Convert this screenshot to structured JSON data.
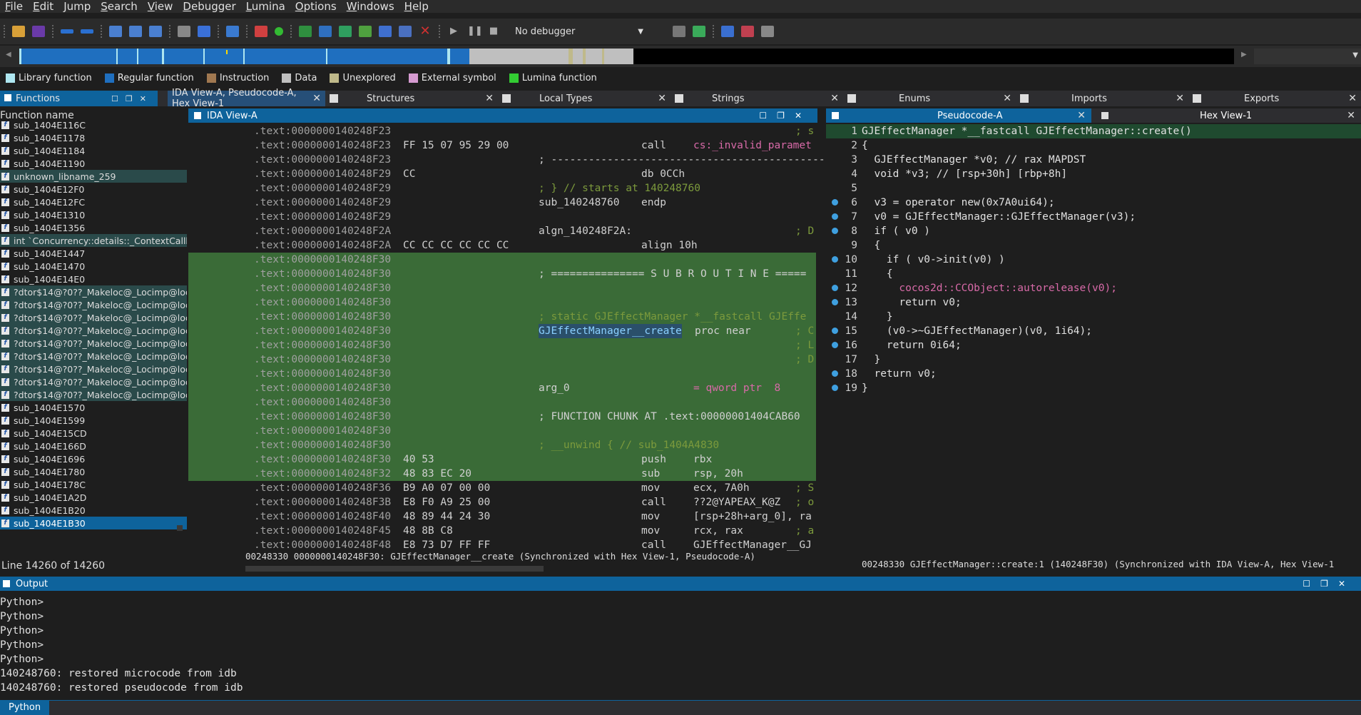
{
  "menu": [
    "File",
    "Edit",
    "Jump",
    "Search",
    "View",
    "Debugger",
    "Lumina",
    "Options",
    "Windows",
    "Help"
  ],
  "toolbar": {
    "debugger_label": "No debugger",
    "dropdown_arrow": "▼"
  },
  "legend": [
    {
      "label": "Library function",
      "color": "#aee6f0"
    },
    {
      "label": "Regular function",
      "color": "#1f6fbf"
    },
    {
      "label": "Instruction",
      "color": "#a07850"
    },
    {
      "label": "Data",
      "color": "#c0c0c0"
    },
    {
      "label": "Unexplored",
      "color": "#bfb98a"
    },
    {
      "label": "External symbol",
      "color": "#d59ad0"
    },
    {
      "label": "Lumina function",
      "color": "#33cc33"
    }
  ],
  "functions_panel": {
    "title": "Functions",
    "column_header": "Function name",
    "status": "Line 14260 of 14260",
    "rows": [
      {
        "name": "sub_1404E116C",
        "type": "normal"
      },
      {
        "name": "sub_1404E1178",
        "type": "normal"
      },
      {
        "name": "sub_1404E1184",
        "type": "normal"
      },
      {
        "name": "sub_1404E1190",
        "type": "normal"
      },
      {
        "name": "unknown_libname_259",
        "type": "lib"
      },
      {
        "name": "sub_1404E12F0",
        "type": "normal"
      },
      {
        "name": "sub_1404E12FC",
        "type": "normal"
      },
      {
        "name": "sub_1404E1310",
        "type": "normal"
      },
      {
        "name": "sub_1404E1356",
        "type": "normal"
      },
      {
        "name": "int `Concurrency::details::_ContextCallb",
        "type": "lib"
      },
      {
        "name": "sub_1404E1447",
        "type": "normal"
      },
      {
        "name": "sub_1404E1470",
        "type": "normal"
      },
      {
        "name": "sub_1404E14E0",
        "type": "normal"
      },
      {
        "name": "?dtor$14@?0??_Makeloc@_Locimp@loca",
        "type": "lib"
      },
      {
        "name": "?dtor$14@?0??_Makeloc@_Locimp@loca",
        "type": "lib"
      },
      {
        "name": "?dtor$14@?0??_Makeloc@_Locimp@loca",
        "type": "lib"
      },
      {
        "name": "?dtor$14@?0??_Makeloc@_Locimp@loca",
        "type": "lib"
      },
      {
        "name": "?dtor$14@?0??_Makeloc@_Locimp@loca",
        "type": "lib"
      },
      {
        "name": "?dtor$14@?0??_Makeloc@_Locimp@loca",
        "type": "lib"
      },
      {
        "name": "?dtor$14@?0??_Makeloc@_Locimp@loca",
        "type": "lib"
      },
      {
        "name": "?dtor$14@?0??_Makeloc@_Locimp@loca",
        "type": "lib"
      },
      {
        "name": "?dtor$14@?0??_Makeloc@_Locimp@loca",
        "type": "lib"
      },
      {
        "name": "sub_1404E1570",
        "type": "normal"
      },
      {
        "name": "sub_1404E1599",
        "type": "normal"
      },
      {
        "name": "sub_1404E15CD",
        "type": "normal"
      },
      {
        "name": "sub_1404E166D",
        "type": "normal"
      },
      {
        "name": "sub_1404E1696",
        "type": "normal"
      },
      {
        "name": "sub_1404E1780",
        "type": "normal"
      },
      {
        "name": "sub_1404E178C",
        "type": "normal"
      },
      {
        "name": "sub_1404E1A2D",
        "type": "normal"
      },
      {
        "name": "sub_1404E1B20",
        "type": "normal"
      },
      {
        "name": "sub_1404E1B30",
        "type": "sel"
      }
    ]
  },
  "center_tabs": {
    "active": "IDA View-A, Pseudocode-A, Hex View-1",
    "others": [
      "Structures",
      "Local Types",
      "Strings"
    ]
  },
  "right_tabs": [
    "Enums",
    "Imports",
    "Exports"
  ],
  "ida_view": {
    "title": "IDA View-A",
    "status": "00248330 0000000140248F30: GJEffectManager__create (Synchronized with Hex View-1, Pseudocode-A)",
    "lines": [
      {
        "addr": ".text:0000000140248F23",
        "bytes": "",
        "mn": "",
        "op": "",
        "cm": "; s",
        "green": false
      },
      {
        "addr": ".text:0000000140248F23",
        "bytes": "FF 15 07 95 29 00",
        "mn": "call",
        "op": "cs:_invalid_paramet",
        "cm": "",
        "green": false
      },
      {
        "addr": ".text:0000000140248F23",
        "bytes": "",
        "mn": "",
        "op": "",
        "cm": "; ---------------------------------------------",
        "green": false
      },
      {
        "addr": ".text:0000000140248F29",
        "bytes": "CC",
        "mn": "db 0CCh",
        "op": "",
        "cm": "",
        "green": false
      },
      {
        "addr": ".text:0000000140248F29",
        "bytes": "",
        "mn": "",
        "op": "",
        "cm": "; } // starts at 140248760",
        "green": false
      },
      {
        "addr": ".text:0000000140248F29",
        "bytes": "",
        "mn": "sub_140248760",
        "op": "endp",
        "cm": "",
        "green": false
      },
      {
        "addr": ".text:0000000140248F29",
        "bytes": "",
        "mn": "",
        "op": "",
        "cm": "",
        "green": false
      },
      {
        "addr": ".text:0000000140248F2A",
        "bytes": "",
        "mn": "algn_140248F2A:",
        "op": "",
        "cm": "; D",
        "green": false
      },
      {
        "addr": ".text:0000000140248F2A",
        "bytes": "CC CC CC CC CC CC",
        "mn": "align 10h",
        "op": "",
        "cm": "",
        "green": false
      },
      {
        "addr": ".text:0000000140248F30",
        "bytes": "",
        "mn": "",
        "op": "",
        "cm": "",
        "green": true
      },
      {
        "addr": ".text:0000000140248F30",
        "bytes": "",
        "mn": "",
        "op": "",
        "cm": "; =============== S U B R O U T I N E =====",
        "green": true
      },
      {
        "addr": ".text:0000000140248F30",
        "bytes": "",
        "mn": "",
        "op": "",
        "cm": "",
        "green": true
      },
      {
        "addr": ".text:0000000140248F30",
        "bytes": "",
        "mn": "",
        "op": "",
        "cm": "",
        "green": true
      },
      {
        "addr": ".text:0000000140248F30",
        "bytes": "",
        "mn": "",
        "op": "",
        "cm": "; static GJEffectManager *__fastcall GJEffe",
        "green": true
      },
      {
        "addr": ".text:0000000140248F30",
        "bytes": "",
        "mn": "GJEffectManager__create",
        "op": "proc near",
        "cm": "; C",
        "green": true
      },
      {
        "addr": ".text:0000000140248F30",
        "bytes": "",
        "mn": "",
        "op": "",
        "cm": "; L",
        "green": true
      },
      {
        "addr": ".text:0000000140248F30",
        "bytes": "",
        "mn": "",
        "op": "",
        "cm": "; D",
        "green": true
      },
      {
        "addr": ".text:0000000140248F30",
        "bytes": "",
        "mn": "",
        "op": "",
        "cm": "",
        "green": true
      },
      {
        "addr": ".text:0000000140248F30",
        "bytes": "",
        "mn": "arg_0",
        "op": "= qword ptr  8",
        "cm": "",
        "green": true
      },
      {
        "addr": ".text:0000000140248F30",
        "bytes": "",
        "mn": "",
        "op": "",
        "cm": "",
        "green": true
      },
      {
        "addr": ".text:0000000140248F30",
        "bytes": "",
        "mn": "",
        "op": "",
        "cm": "; FUNCTION CHUNK AT .text:00000001404CAB60",
        "green": true
      },
      {
        "addr": ".text:0000000140248F30",
        "bytes": "",
        "mn": "",
        "op": "",
        "cm": "",
        "green": true
      },
      {
        "addr": ".text:0000000140248F30",
        "bytes": "",
        "mn": "",
        "op": "",
        "cm": "; __unwind { // sub_1404A4830",
        "green": true
      },
      {
        "addr": ".text:0000000140248F30",
        "bytes": "40 53",
        "mn": "push",
        "op": "rbx",
        "cm": "",
        "green": true
      },
      {
        "addr": ".text:0000000140248F32",
        "bytes": "48 83 EC 20",
        "mn": "sub",
        "op": "rsp, 20h",
        "cm": "",
        "green": true
      },
      {
        "addr": ".text:0000000140248F36",
        "bytes": "B9 A0 07 00 00",
        "mn": "mov",
        "op": "ecx, 7A0h",
        "cm": "; S",
        "green": false
      },
      {
        "addr": ".text:0000000140248F3B",
        "bytes": "E8 F0 A9 25 00",
        "mn": "call",
        "op": "??2@YAPEAX_K@Z",
        "cm": "; o",
        "green": false
      },
      {
        "addr": ".text:0000000140248F40",
        "bytes": "48 89 44 24 30",
        "mn": "mov",
        "op": "[rsp+28h+arg_0], ra",
        "cm": "",
        "green": false
      },
      {
        "addr": ".text:0000000140248F45",
        "bytes": "48 8B C8",
        "mn": "mov",
        "op": "rcx, rax",
        "cm": "; a",
        "green": false
      },
      {
        "addr": ".text:0000000140248F48",
        "bytes": "E8 73 D7 FF FF",
        "mn": "call",
        "op": "GJEffectManager__GJ",
        "cm": "",
        "green": false
      }
    ]
  },
  "pseudocode": {
    "title": "Pseudocode-A",
    "hex_tab": "Hex View-1",
    "status": "00248330 GJEffectManager::create:1 (140248F30) (Synchronized with IDA View-A, Hex View-1",
    "lines": [
      {
        "n": "1",
        "t": "GJEffectManager *__fastcall GJEffectManager::create()",
        "dot": false
      },
      {
        "n": "2",
        "t": "{",
        "dot": false
      },
      {
        "n": "3",
        "t": "  GJEffectManager *v0; // rax MAPDST",
        "dot": false
      },
      {
        "n": "4",
        "t": "  void *v3; // [rsp+30h] [rbp+8h]",
        "dot": false
      },
      {
        "n": "5",
        "t": "",
        "dot": false
      },
      {
        "n": "6",
        "t": "  v3 = operator new(0x7A0ui64);",
        "dot": true
      },
      {
        "n": "7",
        "t": "  v0 = GJEffectManager::GJEffectManager(v3);",
        "dot": true
      },
      {
        "n": "8",
        "t": "  if ( v0 )",
        "dot": true
      },
      {
        "n": "9",
        "t": "  {",
        "dot": false
      },
      {
        "n": "10",
        "t": "    if ( v0->init(v0) )",
        "dot": true
      },
      {
        "n": "11",
        "t": "    {",
        "dot": false
      },
      {
        "n": "12",
        "t": "      cocos2d::CCObject::autorelease(v0);",
        "dot": true
      },
      {
        "n": "13",
        "t": "      return v0;",
        "dot": true
      },
      {
        "n": "14",
        "t": "    }",
        "dot": false
      },
      {
        "n": "15",
        "t": "    (v0->~GJEffectManager)(v0, 1i64);",
        "dot": true
      },
      {
        "n": "16",
        "t": "    return 0i64;",
        "dot": true
      },
      {
        "n": "17",
        "t": "  }",
        "dot": false
      },
      {
        "n": "18",
        "t": "  return v0;",
        "dot": true
      },
      {
        "n": "19",
        "t": "}",
        "dot": true
      }
    ]
  },
  "output": {
    "title": "Output",
    "lines": [
      "Python>",
      "Python>",
      "Python>",
      "Python>",
      "Python>",
      "140248760: restored microcode from idb",
      "140248760: restored pseudocode from idb"
    ],
    "lang_button": "Python"
  }
}
